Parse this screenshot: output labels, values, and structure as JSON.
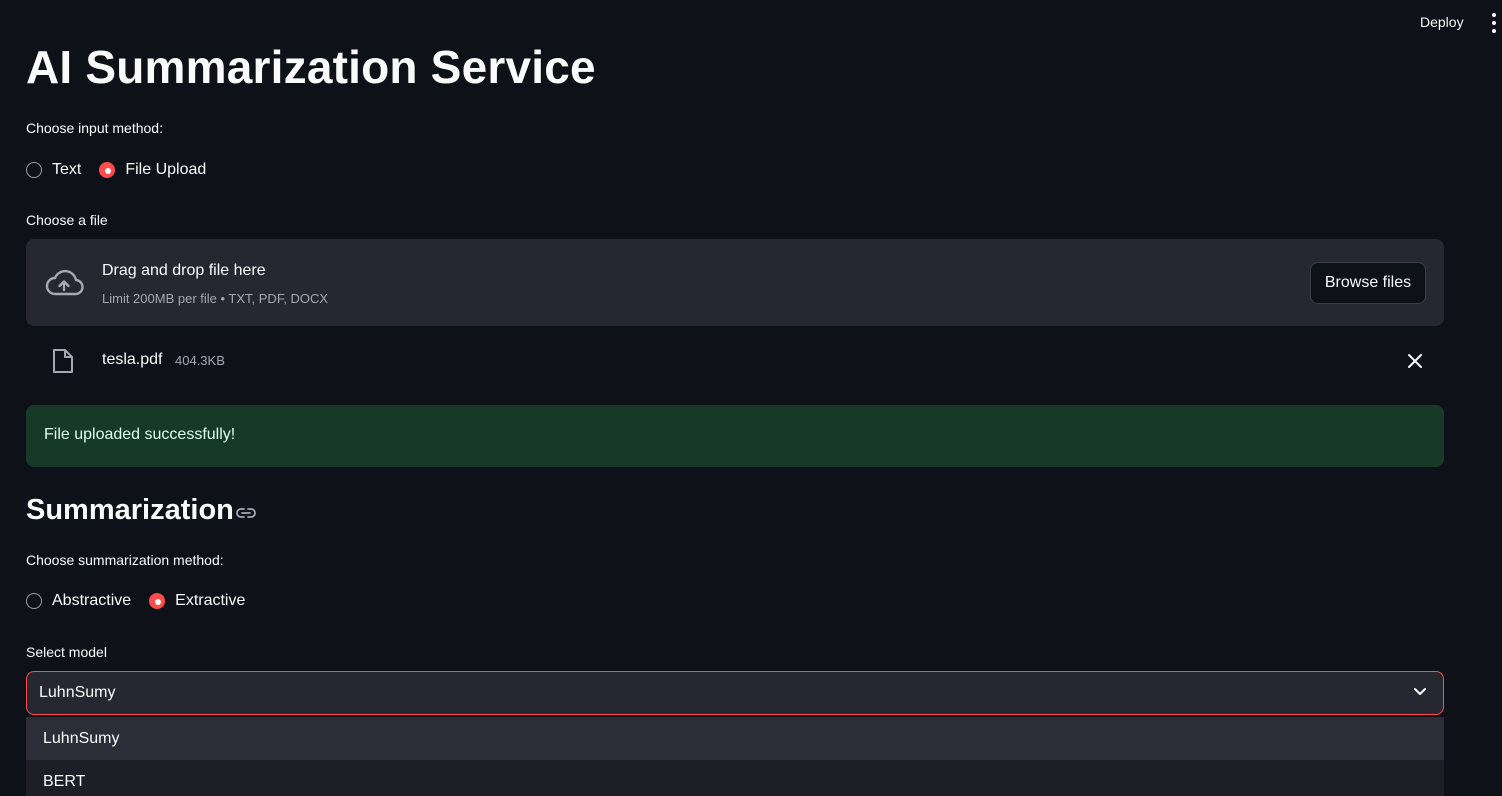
{
  "header": {
    "deploy_label": "Deploy",
    "menu_icon": "more-vert-icon"
  },
  "page": {
    "title": "AI Summarization Service"
  },
  "input_method": {
    "label": "Choose input method:",
    "options": [
      {
        "label": "Text",
        "selected": false
      },
      {
        "label": "File Upload",
        "selected": true
      }
    ]
  },
  "uploader": {
    "label": "Choose a file",
    "icon": "cloud-upload-icon",
    "title": "Drag and drop file here",
    "subtitle": "Limit 200MB per file • TXT, PDF, DOCX",
    "browse_label": "Browse files",
    "file": {
      "icon": "file-icon",
      "name": "tesla.pdf",
      "size": "404.3KB",
      "remove_icon": "close-icon"
    }
  },
  "alert": {
    "type": "success",
    "text": "File uploaded successfully!",
    "color": "#173928"
  },
  "summarization": {
    "heading": "Summarization",
    "anchor_icon": "link-icon",
    "method_label": "Choose summarization method:",
    "methods": [
      {
        "label": "Abstractive",
        "selected": false
      },
      {
        "label": "Extractive",
        "selected": true
      }
    ],
    "model_label": "Select model",
    "model_value": "LuhnSumy",
    "model_options": [
      "LuhnSumy",
      "BERT"
    ]
  },
  "colors": {
    "accent": "#ff4b4b",
    "background": "#0e1117",
    "surface": "#262730"
  }
}
